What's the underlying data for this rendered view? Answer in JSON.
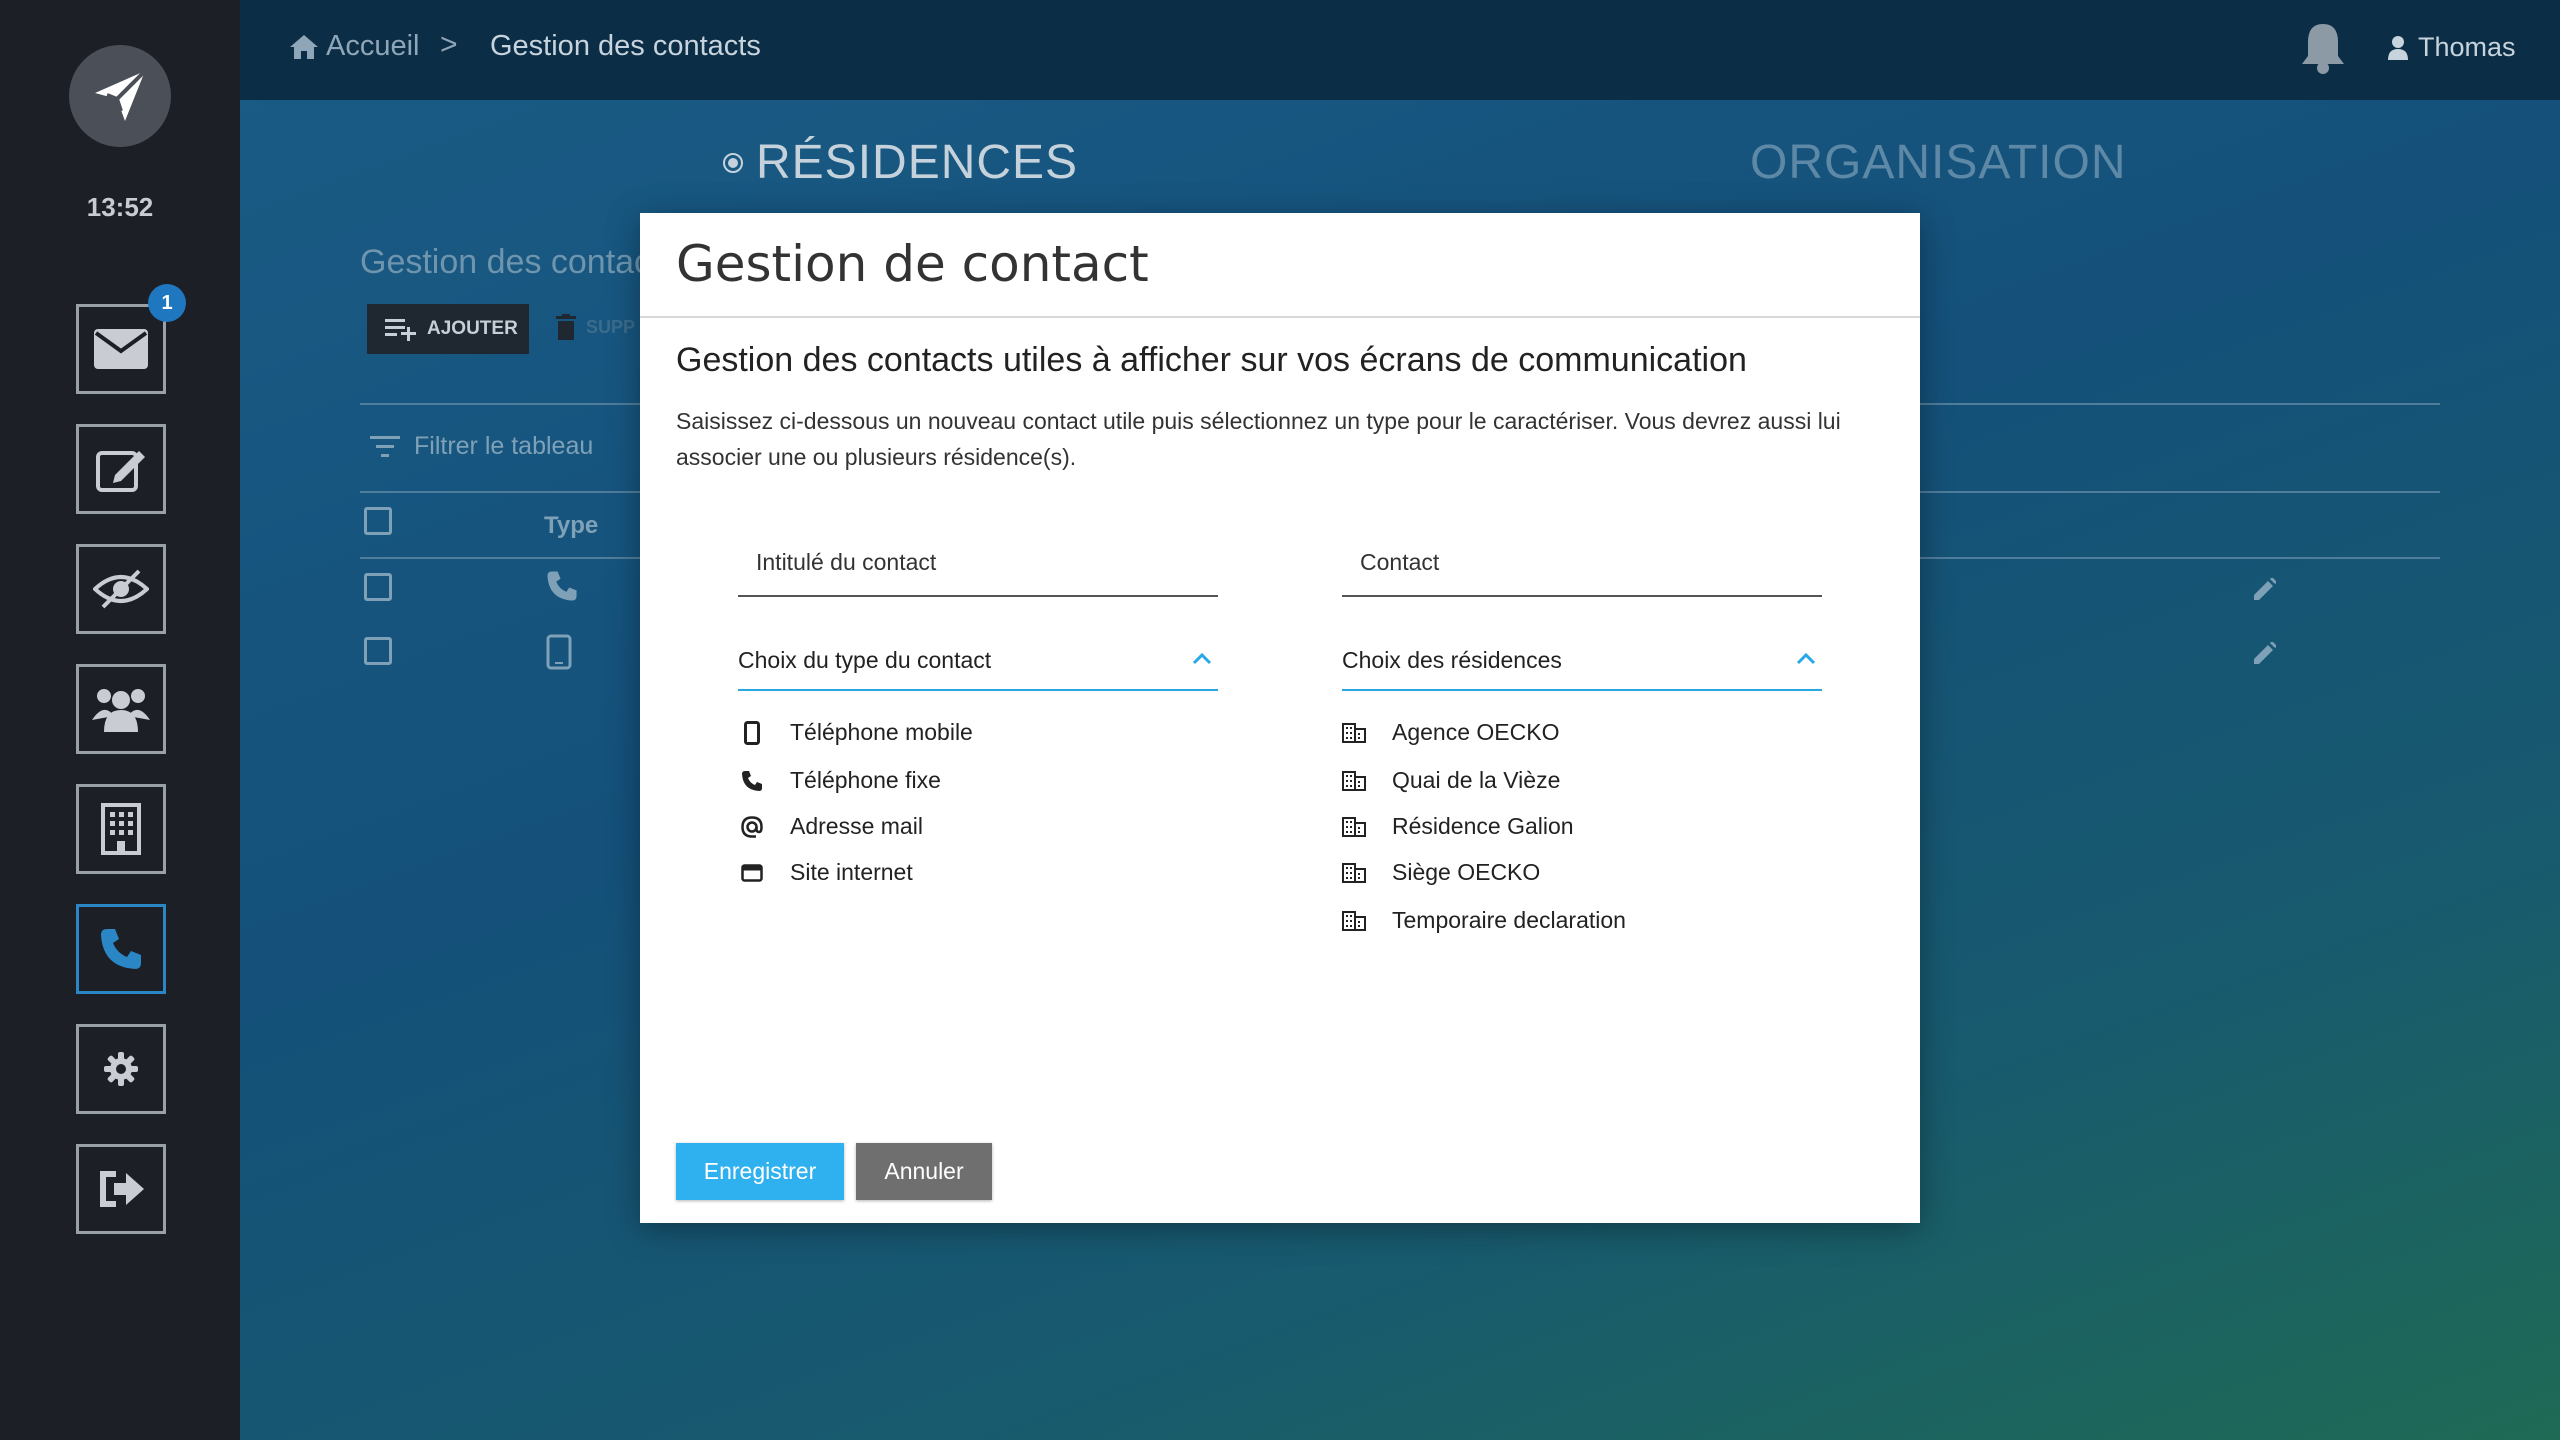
{
  "sidebar": {
    "clock": "13:52",
    "badge_count": "1",
    "items": [
      {
        "name": "messages",
        "icon": "envelope-icon"
      },
      {
        "name": "edit",
        "icon": "pen-square-icon"
      },
      {
        "name": "visibility",
        "icon": "eye-slash-icon"
      },
      {
        "name": "users",
        "icon": "users-icon"
      },
      {
        "name": "buildings",
        "icon": "building-icon"
      },
      {
        "name": "contacts",
        "icon": "phone-icon",
        "active": true
      },
      {
        "name": "settings",
        "icon": "gear-icon"
      },
      {
        "name": "logout",
        "icon": "sign-out-icon"
      }
    ]
  },
  "topbar": {
    "home_label": "Accueil",
    "separator": ">",
    "current": "Gestion des contacts",
    "user_name": "Thomas"
  },
  "background": {
    "tabs": {
      "residences": "RÉSIDENCES",
      "organisation": "ORGANISATION"
    },
    "title": "Gestion des contac",
    "add_label": "AJOUTER",
    "delete_label": "SUPP",
    "filter_placeholder": "Filtrer le tableau",
    "column_type": "Type"
  },
  "modal": {
    "title": "Gestion de contact",
    "heading": "Gestion des contacts utiles à afficher sur vos écrans de communication",
    "description": "Saisissez ci-dessous un nouveau contact utile puis sélectionnez un type pour le caractériser. Vous devrez aussi lui associer une ou plusieurs résidence(s).",
    "contact_label_placeholder": "Intitulé du contact",
    "contact_placeholder": "Contact",
    "type_select_label": "Choix du type du contact",
    "residence_select_label": "Choix des résidences",
    "types": [
      {
        "label": "Téléphone mobile",
        "icon": "mobile-phone-icon"
      },
      {
        "label": "Téléphone fixe",
        "icon": "phone-icon"
      },
      {
        "label": "Adresse mail",
        "icon": "at-icon"
      },
      {
        "label": "Site internet",
        "icon": "browser-window-icon"
      }
    ],
    "residences": [
      {
        "label": "Agence OECKO"
      },
      {
        "label": "Quai de la Vièze"
      },
      {
        "label": "Résidence Galion"
      },
      {
        "label": "Siège OECKO"
      },
      {
        "label": "Temporaire declaration"
      }
    ],
    "save_label": "Enregistrer",
    "cancel_label": "Annuler"
  },
  "colors": {
    "accent": "#2fb0ef",
    "sidebar": "#1c1f25",
    "topbar": "#0b2e46",
    "badge": "#1f77c0",
    "cancel": "#6f6f6f"
  }
}
